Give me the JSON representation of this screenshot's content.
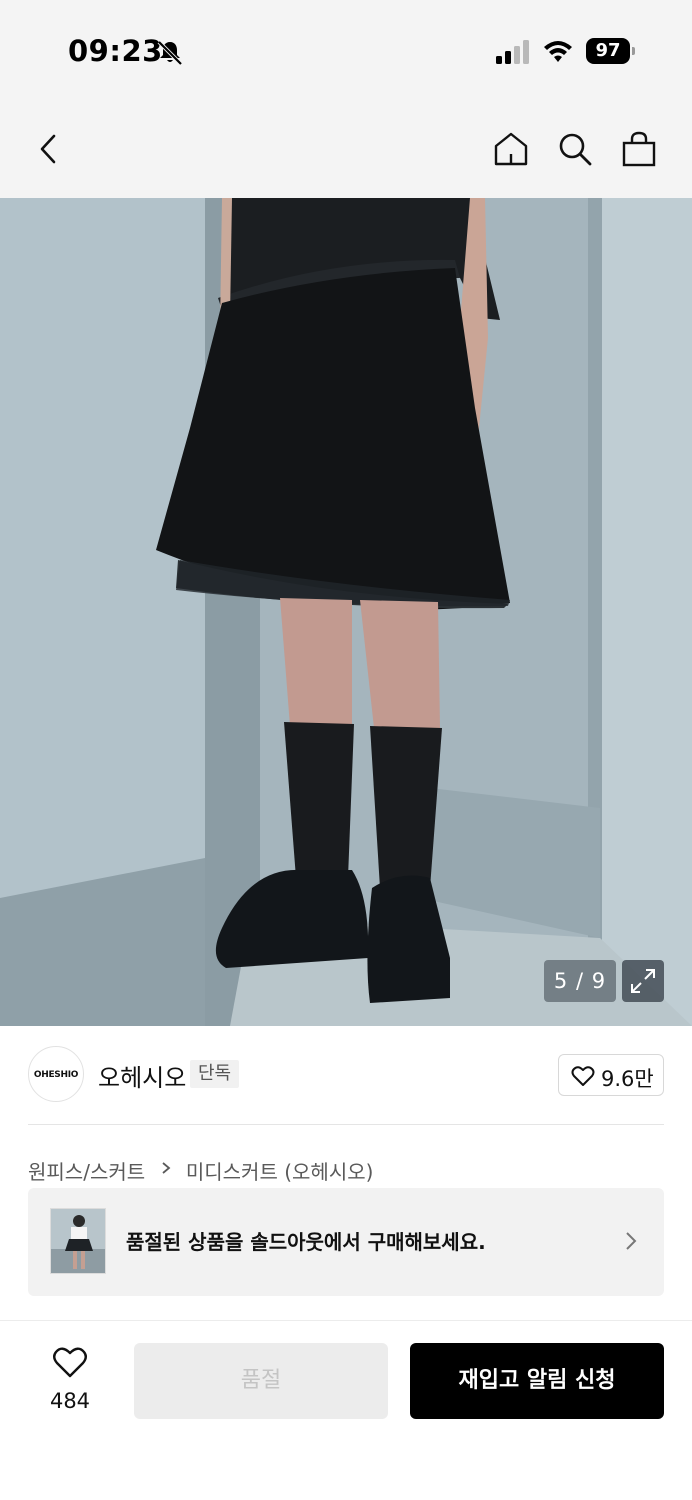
{
  "status_bar": {
    "time": "09:23",
    "battery": "97"
  },
  "nav": {
    "back_icon": "chevron-left-icon",
    "home_icon": "home-icon",
    "search_icon": "search-icon",
    "cart_icon": "shopping-bag-icon"
  },
  "gallery": {
    "counter": "5 / 9",
    "expand_icon": "expand-icon"
  },
  "brand": {
    "logo_text": "OHESHIO",
    "name": "오헤시오",
    "badge": "단독",
    "like_count": "9.6만"
  },
  "breadcrumb": {
    "category": "원피스/스커트",
    "subcategory": "미디스커트 (오헤시오)"
  },
  "banner": {
    "text": "품절된 상품을 솔드아웃에서 구매해보세요."
  },
  "bottom_bar": {
    "wish_count": "484",
    "soldout_label": "품절",
    "restock_label": "재입고 알림 신청"
  },
  "colors": {
    "background": "#f4f4f4",
    "primary_button": "#000000",
    "disabled_button": "#ececec"
  }
}
